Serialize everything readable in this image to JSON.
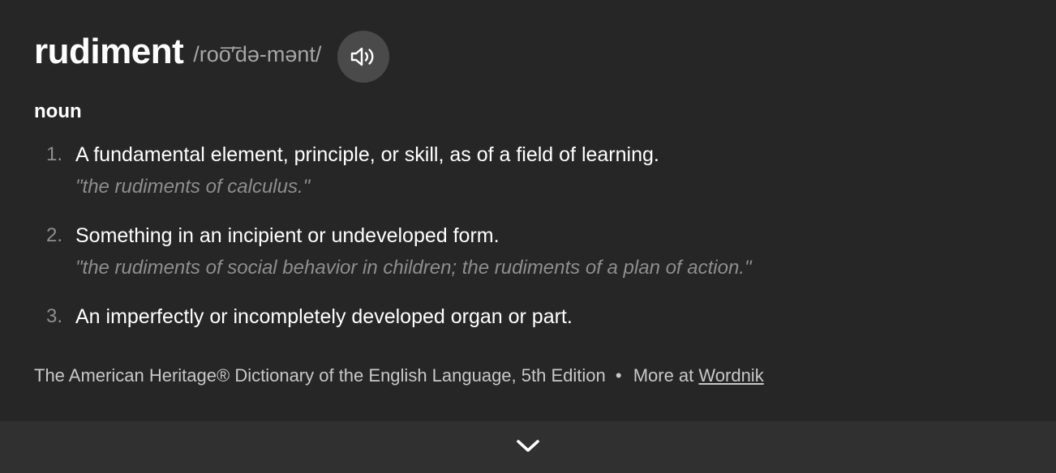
{
  "entry": {
    "word": "rudiment",
    "pronunciation": "/roo͞′də-mənt/",
    "audio_icon": "speaker-icon",
    "part_of_speech": "noun"
  },
  "definitions": [
    {
      "number": "1.",
      "text": "A fundamental element, principle, or skill, as of a field of learning.",
      "example": "\"the rudiments of calculus.\""
    },
    {
      "number": "2.",
      "text": "Something in an incipient or undeveloped form.",
      "example": "\"the rudiments of social behavior in children; the rudiments of a plan of action.\""
    },
    {
      "number": "3.",
      "text": "An imperfectly or incompletely developed organ or part."
    }
  ],
  "source": {
    "dictionary": "The American Heritage® Dictionary of the English Language, 5th Edition",
    "separator": "•",
    "more_label": "More at",
    "link_label": "Wordnik"
  },
  "footer": {
    "expand_icon": "chevron-down-icon"
  },
  "colors": {
    "background": "#262626",
    "footer_background": "#303030",
    "audio_button": "#4a4a4a",
    "muted_text": "#8e8e8e"
  }
}
